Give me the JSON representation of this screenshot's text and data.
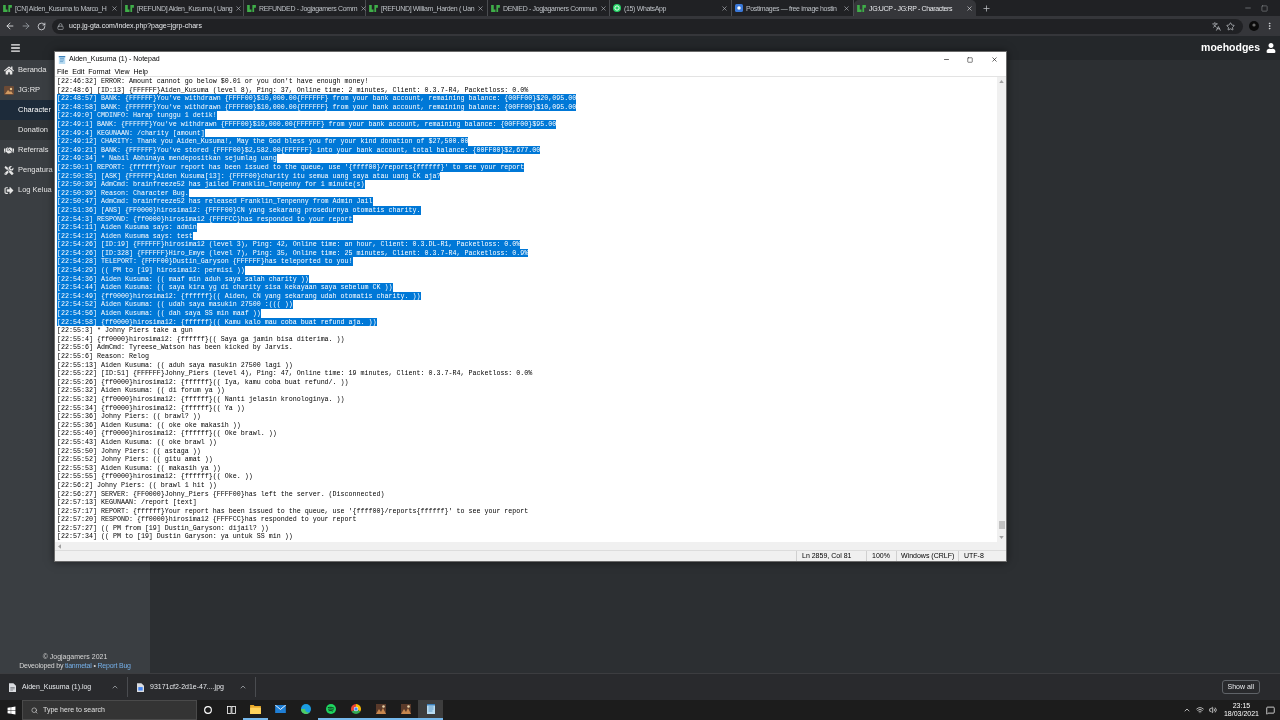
{
  "browser": {
    "tabs": [
      {
        "kind": "site",
        "title": "[CN] Aiden_Kusuma to Marco_H",
        "selected": false
      },
      {
        "kind": "site",
        "title": "[REFUND] Aiden_Kusuma ( Uang",
        "selected": false
      },
      {
        "kind": "site",
        "title": "REFUNDED - Jogjagamers Comm",
        "selected": false
      },
      {
        "kind": "site",
        "title": "[REFUND] William_Harden ( Uan",
        "selected": false
      },
      {
        "kind": "site",
        "title": "DENIED - Jogjagamers Commun",
        "selected": false
      },
      {
        "kind": "chat",
        "title": "(15) WhatsApp",
        "selected": false
      },
      {
        "kind": "image",
        "title": "Postimages — free image hostin",
        "selected": false
      },
      {
        "kind": "site",
        "title": "JG:UCP - JG:RP - Characters",
        "selected": true
      }
    ],
    "address": {
      "url": "ucp.jg-gta.com/index.php?page=jgrp-chars"
    }
  },
  "page": {
    "header": {
      "username": "moehodges"
    },
    "sidebar": {
      "items": [
        {
          "kind": "home",
          "label": "Beranda",
          "selected": false
        },
        {
          "kind": "game",
          "label": "JG:RP",
          "selected": false,
          "children": [
            {
              "label": "Character",
              "selected": true
            },
            {
              "label": "Donation",
              "selected": false
            }
          ]
        },
        {
          "kind": "referral",
          "label": "Referrals",
          "selected": false
        },
        {
          "kind": "settings",
          "label": "Pengatura",
          "selected": false
        },
        {
          "kind": "logout",
          "label": "Log Kelua",
          "selected": false
        }
      ],
      "footer": {
        "copyright": "© Jogjagamers 2021",
        "credit": "Deveoloped by",
        "author": "tianmetal",
        "separator": "•",
        "report": "Report Bug"
      }
    }
  },
  "notepad": {
    "title": "Aiden_Kusuma (1) - Notepad",
    "menu": [
      "File",
      "Edit",
      "Format",
      "View",
      "Help"
    ],
    "lines": [
      {
        "text": "[22:46:32] ERROR: Amount cannot go below $0.01 or you don't have enough money!",
        "selected": false
      },
      {
        "text": "[22:48:6] [ID:13] {FFFFFF}Aiden_Kusuma (level 8), Ping: 37, Online time: 2 minutes, Client: 0.3.7-R4, Packetloss: 0.0%",
        "selected": false
      },
      {
        "text": "[22:48:57] BANK: {FFFFFF}You've withdrawn {FFFF00}$10,000.00{FFFFFF} from your bank account, remaining balance: {00FF00}$20,095.00",
        "selected": true
      },
      {
        "text": "[22:48:58] BANK: {FFFFFF}You've withdrawn {FFFF00}$10,000.00{FFFFFF} from your bank account, remaining balance: {00FF00}$10,095.00",
        "selected": true
      },
      {
        "text": "[22:49:0] CMDINFO: Harap tunggu 1 detik!",
        "selected": true
      },
      {
        "text": "[22:49:1] BANK: {FFFFFF}You've withdrawn {FFFF00}$10,000.00{FFFFFF} from your bank account, remaining balance: {00FF00}$95.00",
        "selected": true
      },
      {
        "text": "[22:49:4] KEGUNAAN: /charity [amount]",
        "selected": true
      },
      {
        "text": "[22:49:12] CHARITY: Thank you Aiden_Kusuma!, May the God bless you for your kind donation of $27,500.00",
        "selected": true
      },
      {
        "text": "[22:49:21] BANK: {FFFFFF}You've stored {FFFF00}$2,582.00{FFFFFF} into your bank account, total balance: {00FF00}$2,677.00",
        "selected": true
      },
      {
        "text": "[22:49:34] * Nabil Abhinaya mendepositkan sejumlag uang",
        "selected": true
      },
      {
        "text": "[22:50:1] REPORT: {ffffff}Your report has been issued to the queue, use '{ffff00}/reports{ffffff}' to see your report",
        "selected": true
      },
      {
        "text": "[22:50:35] [ASK] {FFFFFF}Aiden Kusuma[13]: {FFFF00}charity itu semua uang saya atau uang CK aja?",
        "selected": true
      },
      {
        "text": "[22:50:39] AdmCmd: brainfreeze52 has jailed Franklin_Tenpenny for 1 minute(s)",
        "selected": true
      },
      {
        "text": "[22:50:39] Reason: Character Bug.",
        "selected": true
      },
      {
        "text": "[22:50:47] AdmCmd: brainfreeze52 has released Franklin_Tenpenny from Admin Jail",
        "selected": true
      },
      {
        "text": "[22:51:36] [ANS] {FF0000}hirosima12: {FFFF00}CN yang sekarang prosedurnya otomatis charity.",
        "selected": true
      },
      {
        "text": "[22:54:3] RESPOND: {ff0000}hirosima12 {FFFFCC}has responded to your report",
        "selected": true
      },
      {
        "text": "[22:54:11] Aiden Kusuma says: admin",
        "selected": true
      },
      {
        "text": "[22:54:12] Aiden Kusuma says: test",
        "selected": true
      },
      {
        "text": "[22:54:26] [ID:19] {FFFFFF}hirosima12 (level 3), Ping: 42, Online time: an hour, Client: 0.3.DL-R1, Packetloss: 0.0%",
        "selected": true
      },
      {
        "text": "[22:54:26] [ID:328] {FFFFFF}Hiro_Emye (level 7), Ping: 35, Online time: 25 minutes, Client: 0.3.7-R4, Packetloss: 0.9%",
        "selected": true
      },
      {
        "text": "[22:54:28] TELEPORT: {FFFF00}Dustin_Garyson {FFFFFF}has teleported to you!",
        "selected": true
      },
      {
        "text": "[22:54:29] (( PM to [19] hirosima12: permisi ))",
        "selected": true
      },
      {
        "text": "[22:54:36] Aiden Kusuma: (( maaf min aduh saya salah charity ))",
        "selected": true
      },
      {
        "text": "[22:54:44] Aiden Kusuma: (( saya kira yg di charity sisa kekayaan saya sebelum CK ))",
        "selected": true
      },
      {
        "text": "[22:54:49] {ff0000}hirosima12: {ffffff}(( Aiden, CN yang sekarang udah otomatis charity. ))",
        "selected": true
      },
      {
        "text": "[22:54:52] Aiden Kusuma: (( udah saya masukin 27500 :((( ))",
        "selected": true
      },
      {
        "text": "[22:54:56] Aiden Kusuma: (( dah saya SS min maaf ))",
        "selected": true
      },
      {
        "text": "[22:54:58] {ff0000}hirosima12: {ffffff}(( Kamu kalo mau coba buat refund aja. ))",
        "selected": true
      },
      {
        "text": "[22:55:3] * Johny Piers take a gun",
        "selected": false
      },
      {
        "text": "[22:55:4] {ff0000}hirosima12: {ffffff}(( Saya ga jamin bisa diterima. ))",
        "selected": false
      },
      {
        "text": "[22:55:6] AdmCmd: Tyreese_Watson has been kicked by Jarvis.",
        "selected": false
      },
      {
        "text": "[22:55:6] Reason: Relog",
        "selected": false
      },
      {
        "text": "[22:55:13] Aiden Kusuma: (( aduh saya masukin 27500 lagi ))",
        "selected": false
      },
      {
        "text": "[22:55:22] [ID:51] {FFFFFF}Johny_Piers (level 4), Ping: 47, Online time: 19 minutes, Client: 0.3.7-R4, Packetloss: 0.0%",
        "selected": false
      },
      {
        "text": "[22:55:26] {ff0000}hirosima12: {ffffff}(( Iya, kamu coba buat refund/. ))",
        "selected": false
      },
      {
        "text": "[22:55:32] Aiden Kusuma: (( di forum ya ))",
        "selected": false
      },
      {
        "text": "[22:55:32] {ff0000}hirosima12: {ffffff}(( Nanti jelasin kronologinya. ))",
        "selected": false
      },
      {
        "text": "[22:55:34] {ff0000}hirosima12: {ffffff}(( Ya ))",
        "selected": false
      },
      {
        "text": "[22:55:36] Johny Piers: (( brawl? ))",
        "selected": false
      },
      {
        "text": "[22:55:36] Aiden Kusuma: (( oke oke makasih ))",
        "selected": false
      },
      {
        "text": "[22:55:40] {ff0000}hirosima12: {ffffff}(( Oke brawl. ))",
        "selected": false
      },
      {
        "text": "[22:55:43] Aiden Kusuma: (( oke brawl ))",
        "selected": false
      },
      {
        "text": "[22:55:50] Johny Piers: (( astaga ))",
        "selected": false
      },
      {
        "text": "[22:55:52] Johny Piers: (( gitu amat ))",
        "selected": false
      },
      {
        "text": "[22:55:53] Aiden Kusuma: (( makasih ya ))",
        "selected": false
      },
      {
        "text": "[22:55:55] {ff0000}hirosima12: {ffffff}(( Oke. ))",
        "selected": false
      },
      {
        "text": "[22:56:2] Johny Piers: (( brawl 1 hit ))",
        "selected": false
      },
      {
        "text": "[22:56:27] SERVER: {FF0000}Johny_Piers {FFFF00}has left the server. (Disconnected)",
        "selected": false
      },
      {
        "text": "[22:57:13] KEGUNAAN: /report [text]",
        "selected": false
      },
      {
        "text": "[22:57:17] REPORT: {ffffff}Your report has been issued to the queue, use '{ffff00}/reports{ffffff}' to see your report",
        "selected": false
      },
      {
        "text": "[22:57:20] RESPOND: {ff0000}hirosima12 {FFFFCC}has responded to your report",
        "selected": false
      },
      {
        "text": "[22:57:27] (( PM from [19] Dustin_Garyson: dijail? ))",
        "selected": false
      },
      {
        "text": "[22:57:34] (( PM to [19] Dustin Garyson: ya untuk SS min ))",
        "selected": false
      }
    ],
    "status": {
      "position": "Ln 2859, Col 81",
      "zoom": "100%",
      "line_endings": "Windows (CRLF)",
      "encoding": "UTF-8"
    }
  },
  "downloads": {
    "items": [
      {
        "kind": "text",
        "name": "Aiden_Kusuma (1).log"
      },
      {
        "kind": "image",
        "name": "93171cf2-2d1e-47....jpg"
      }
    ],
    "show_all": "Show all"
  },
  "taskbar": {
    "search": {
      "placeholder": "Type here to search"
    },
    "apps": [
      {
        "kind": "files",
        "running": true,
        "selected": false
      },
      {
        "kind": "mail",
        "running": false,
        "selected": false
      },
      {
        "kind": "web",
        "running": false,
        "selected": false
      },
      {
        "kind": "music",
        "running": true,
        "selected": false
      },
      {
        "kind": "browser",
        "running": true,
        "selected": false
      },
      {
        "kind": "game",
        "running": true,
        "selected": false
      },
      {
        "kind": "game",
        "running": true,
        "selected": false
      },
      {
        "kind": "notepad",
        "running": true,
        "selected": true
      }
    ],
    "clock": {
      "time": "23:15",
      "date": "18/03/2021"
    }
  }
}
